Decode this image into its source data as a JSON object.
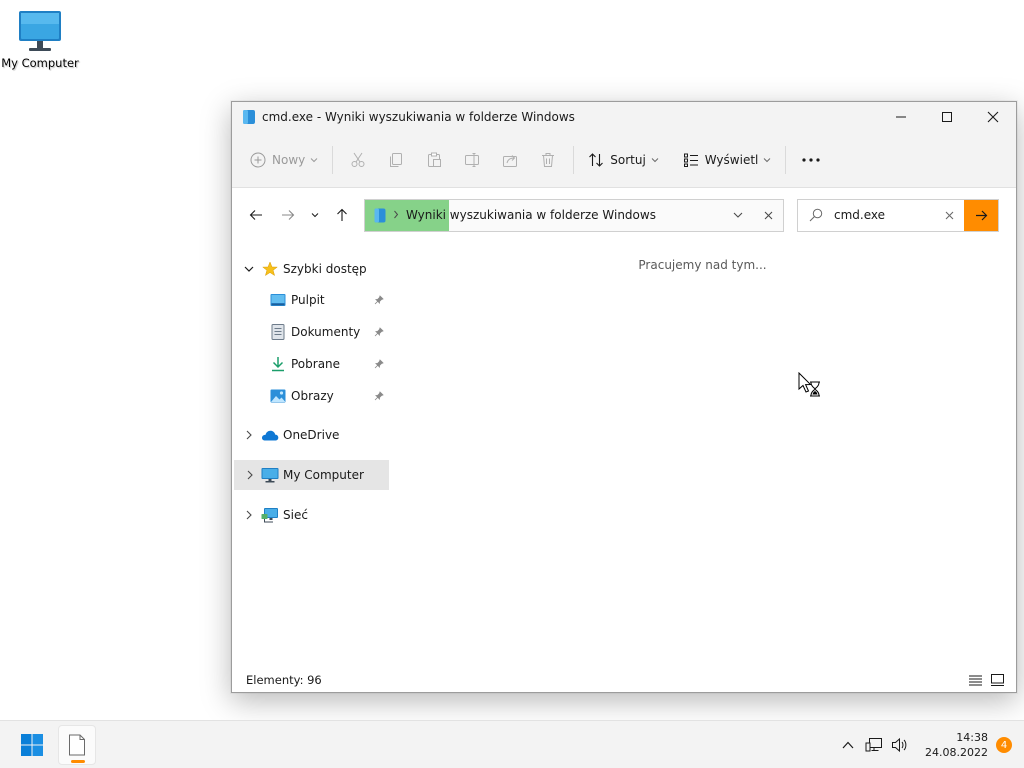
{
  "desktop": {
    "icons": [
      {
        "label": "My Computer",
        "icon": "monitor-icon"
      }
    ]
  },
  "window": {
    "title": "cmd.exe - Wyniki wyszukiwania w folderze Windows",
    "controls": {
      "minimize": "minimize-icon",
      "maximize": "maximize-icon",
      "close": "close-icon"
    }
  },
  "toolbar": {
    "new_label": "Nowy",
    "sort_label": "Sortuj",
    "view_label": "Wyświetl",
    "disabled_actions": [
      "cut-icon",
      "copy-icon",
      "paste-icon",
      "rename-icon",
      "share-icon",
      "delete-icon"
    ],
    "more_icon": "more-icon"
  },
  "address_bar": {
    "breadcrumb": "Wyniki wyszukiwania w folderze Windows",
    "search_progress": 0.2
  },
  "search": {
    "value": "cmd.exe"
  },
  "sidebar": {
    "quick_access": "Szybki dostęp",
    "pinned": [
      {
        "label": "Pulpit",
        "icon": "desktop-folder-icon"
      },
      {
        "label": "Dokumenty",
        "icon": "documents-icon"
      },
      {
        "label": "Pobrane",
        "icon": "downloads-icon"
      },
      {
        "label": "Obrazy",
        "icon": "pictures-icon"
      }
    ],
    "onedrive": "OneDrive",
    "my_computer": "My Computer",
    "network": "Sieć"
  },
  "content": {
    "status_message": "Pracujemy nad tym..."
  },
  "statusbar": {
    "items_text": "Elementy: 96"
  },
  "taskbar": {
    "time": "14:38",
    "date": "24.08.2022",
    "notifications": "4"
  },
  "colors": {
    "accent": "#ff8c00",
    "progress": "#86d289",
    "selection": "#e5e5e5"
  }
}
